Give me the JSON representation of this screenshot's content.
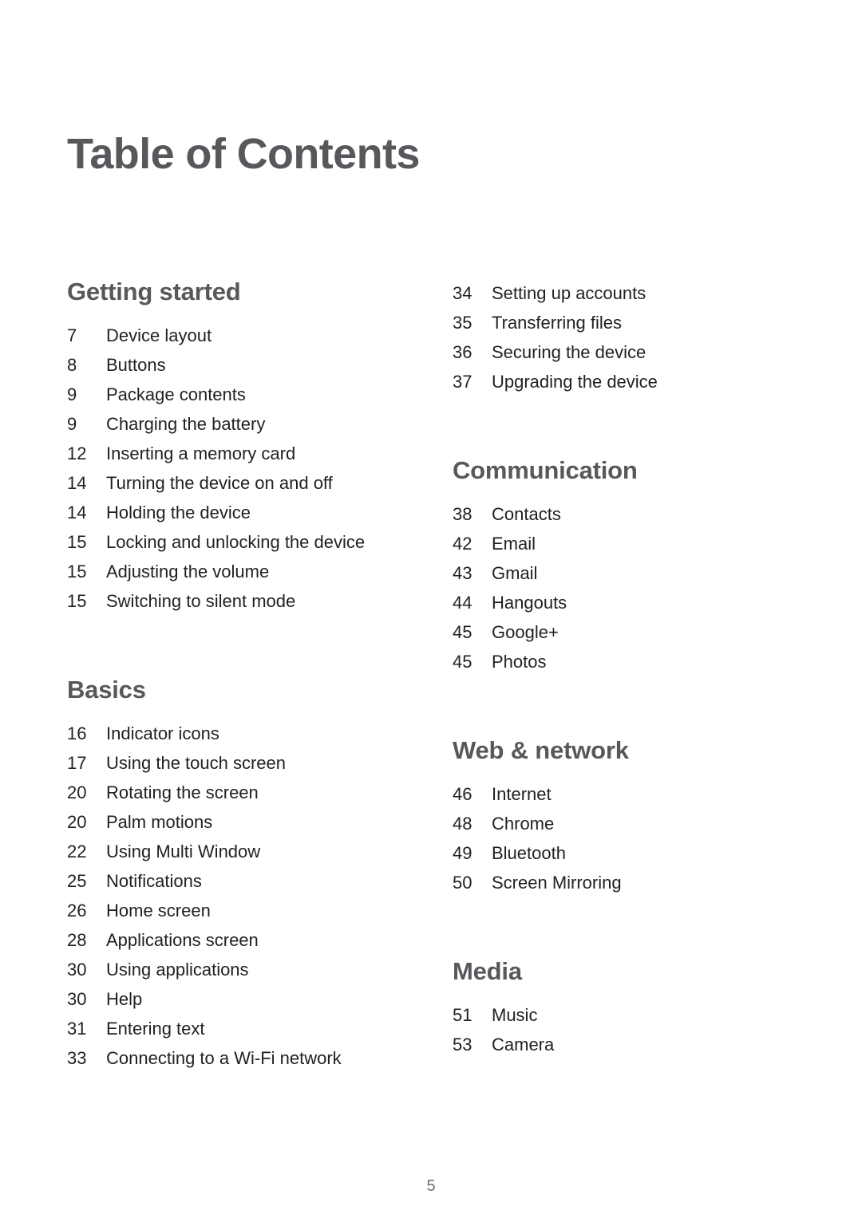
{
  "document": {
    "title": "Table of Contents",
    "folio": "5"
  },
  "columns": {
    "left": [
      {
        "heading": "Getting started",
        "has_heading": true,
        "entries": [
          {
            "page": "7",
            "label": "Device layout"
          },
          {
            "page": "8",
            "label": "Buttons"
          },
          {
            "page": "9",
            "label": "Package contents"
          },
          {
            "page": "9",
            "label": "Charging the battery"
          },
          {
            "page": "12",
            "label": "Inserting a memory card"
          },
          {
            "page": "14",
            "label": "Turning the device on and off"
          },
          {
            "page": "14",
            "label": "Holding the device"
          },
          {
            "page": "15",
            "label": "Locking and unlocking the device"
          },
          {
            "page": "15",
            "label": "Adjusting the volume"
          },
          {
            "page": "15",
            "label": "Switching to silent mode"
          }
        ]
      },
      {
        "heading": "Basics",
        "has_heading": true,
        "entries": [
          {
            "page": "16",
            "label": "Indicator icons"
          },
          {
            "page": "17",
            "label": "Using the touch screen"
          },
          {
            "page": "20",
            "label": "Rotating the screen"
          },
          {
            "page": "20",
            "label": "Palm motions"
          },
          {
            "page": "22",
            "label": "Using Multi Window"
          },
          {
            "page": "25",
            "label": "Notifications"
          },
          {
            "page": "26",
            "label": "Home screen"
          },
          {
            "page": "28",
            "label": "Applications screen"
          },
          {
            "page": "30",
            "label": "Using applications"
          },
          {
            "page": "30",
            "label": "Help"
          },
          {
            "page": "31",
            "label": "Entering text"
          },
          {
            "page": "33",
            "label": "Connecting to a Wi-Fi network"
          }
        ]
      }
    ],
    "right": [
      {
        "heading": "",
        "has_heading": false,
        "entries": [
          {
            "page": "34",
            "label": "Setting up accounts"
          },
          {
            "page": "35",
            "label": "Transferring files"
          },
          {
            "page": "36",
            "label": "Securing the device"
          },
          {
            "page": "37",
            "label": "Upgrading the device"
          }
        ]
      },
      {
        "heading": "Communication",
        "has_heading": true,
        "entries": [
          {
            "page": "38",
            "label": "Contacts"
          },
          {
            "page": "42",
            "label": "Email"
          },
          {
            "page": "43",
            "label": "Gmail"
          },
          {
            "page": "44",
            "label": "Hangouts"
          },
          {
            "page": "45",
            "label": "Google+"
          },
          {
            "page": "45",
            "label": "Photos"
          }
        ]
      },
      {
        "heading": "Web & network",
        "has_heading": true,
        "entries": [
          {
            "page": "46",
            "label": "Internet"
          },
          {
            "page": "48",
            "label": "Chrome"
          },
          {
            "page": "49",
            "label": "Bluetooth"
          },
          {
            "page": "50",
            "label": "Screen Mirroring"
          }
        ]
      },
      {
        "heading": "Media",
        "has_heading": true,
        "entries": [
          {
            "page": "51",
            "label": "Music"
          },
          {
            "page": "53",
            "label": "Camera"
          }
        ]
      }
    ]
  },
  "colors": {
    "heading": "#58585c",
    "body": "#231f20",
    "folio": "#6d7276",
    "background": "#ffffff"
  }
}
